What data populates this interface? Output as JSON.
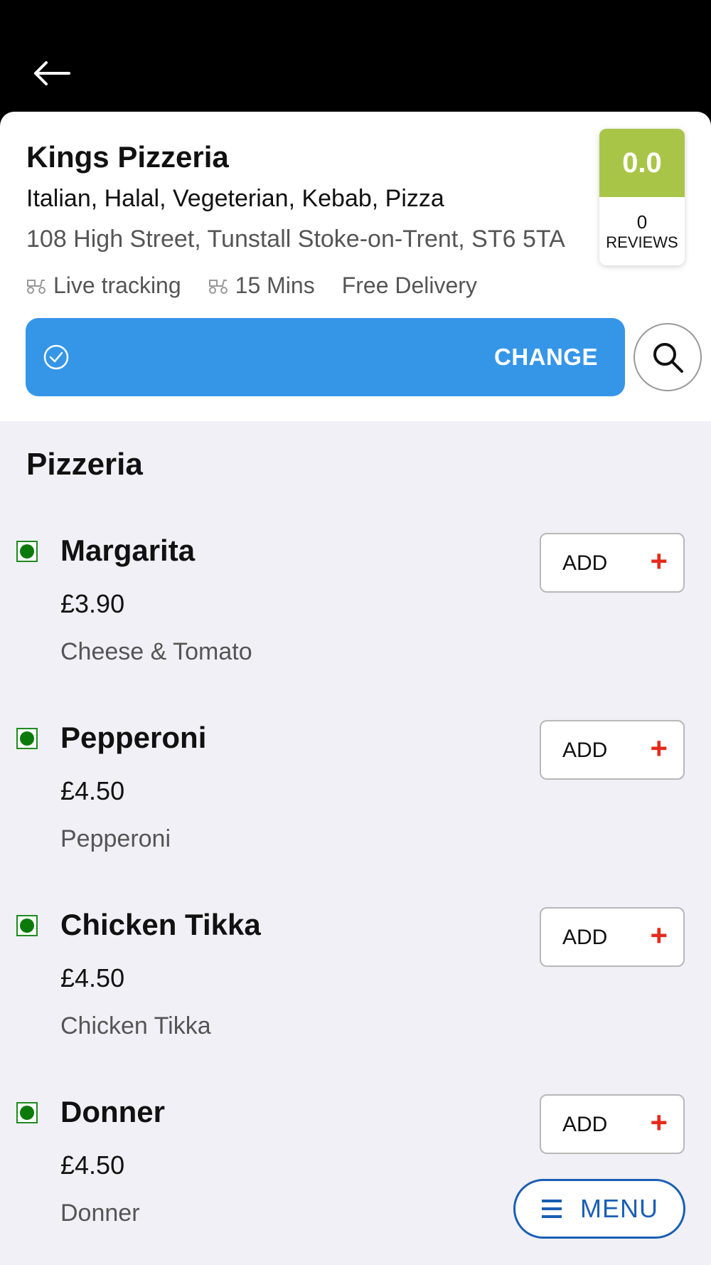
{
  "restaurant": {
    "name": "Kings Pizzeria",
    "cuisines": "Italian, Halal, Vegeterian, Kebab, Pizza",
    "address": "108 High Street, Tunstall Stoke-on-Trent, ST6 5TA",
    "live_tracking": "Live tracking",
    "delivery_time": "15 Mins",
    "delivery_fee": "Free Delivery"
  },
  "rating": {
    "score": "0.0",
    "count": "0",
    "label": "REVIEWS",
    "score_bg": "#a9c548"
  },
  "order_bar": {
    "change_label": "CHANGE",
    "bg": "#3596e8"
  },
  "section": {
    "title": "Pizzeria"
  },
  "items": [
    {
      "name": "Margarita",
      "price": "£3.90",
      "desc": "Cheese & Tomato",
      "add_label": "ADD",
      "add_icon": "+"
    },
    {
      "name": "Pepperoni",
      "price": "£4.50",
      "desc": "Pepperoni",
      "add_label": "ADD",
      "add_icon": "+"
    },
    {
      "name": "Chicken Tikka",
      "price": "£4.50",
      "desc": "Chicken Tikka",
      "add_label": "ADD",
      "add_icon": "+"
    },
    {
      "name": "Donner",
      "price": "£4.50",
      "desc": "Donner",
      "add_label": "ADD",
      "add_icon": "+"
    }
  ],
  "menu_button": {
    "label": "MENU"
  },
  "icons": {
    "back": "arrow-left-icon",
    "scooter": "scooter-icon",
    "check": "check-circle-icon",
    "search": "search-icon",
    "veg": "veg-indicator-icon",
    "menu": "hamburger-icon"
  }
}
